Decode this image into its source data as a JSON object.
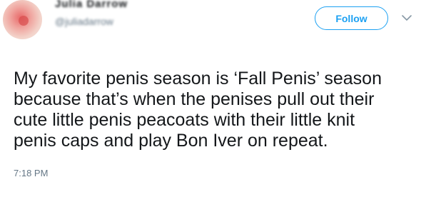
{
  "author": {
    "display_name": "Julia Darrow",
    "handle": "@juliadarrow"
  },
  "actions": {
    "follow_label": "Follow",
    "menu_icon": "chevron-down-icon"
  },
  "tweet": {
    "lines": [
      "My favorite penis season is ‘Fall Penis’ season",
      "because that’s when the penises pull out their",
      "cute little penis peacoats with their little knit",
      "penis caps and play Bon Iver on repeat."
    ],
    "time": "7:18 PM"
  },
  "colors": {
    "accent": "#1da1f2",
    "text": "#14171a",
    "secondary_text": "#657786"
  }
}
